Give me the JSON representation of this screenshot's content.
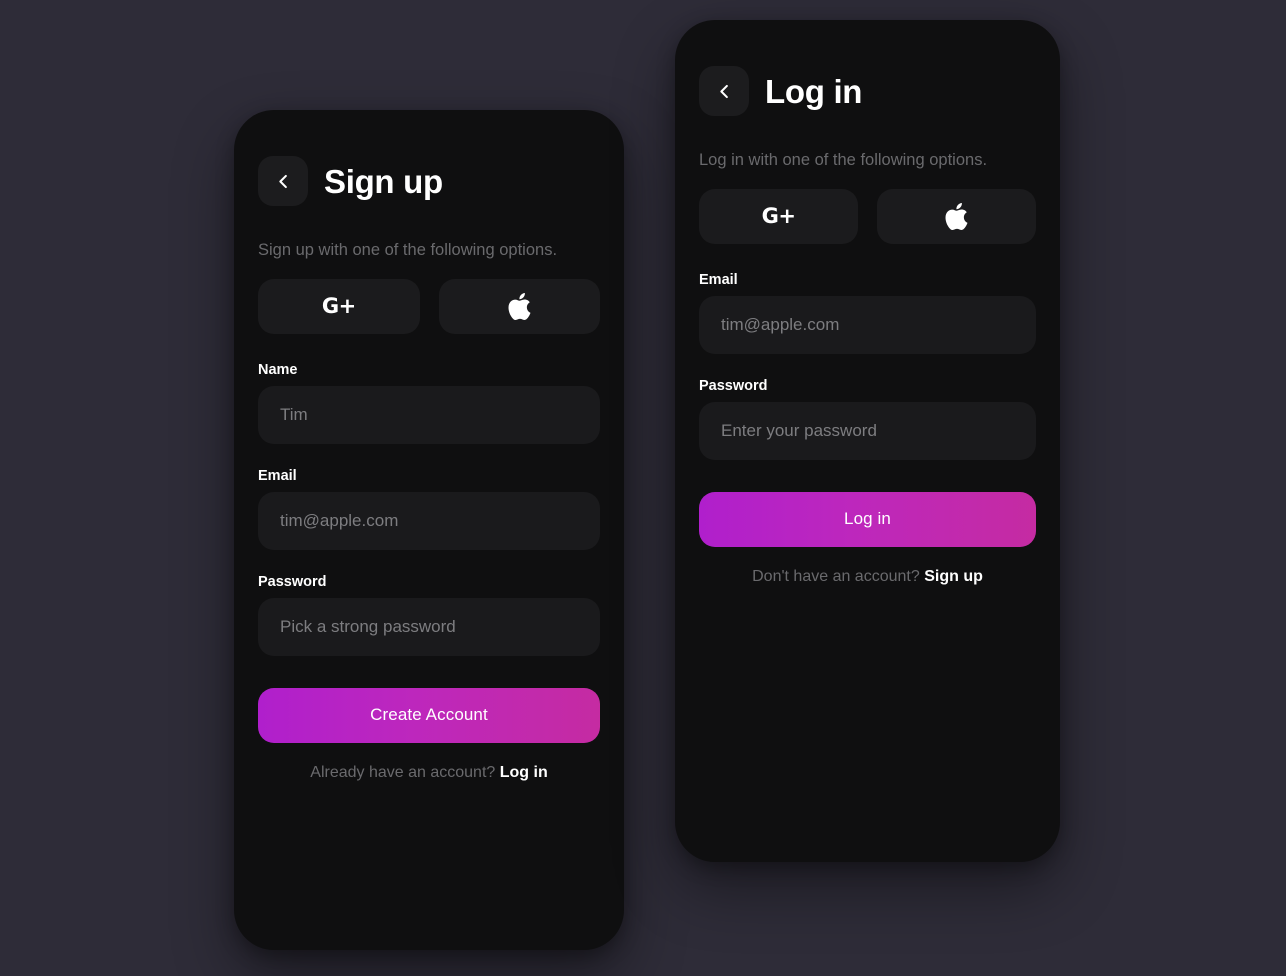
{
  "theme": {
    "page_background": "#2e2c38",
    "card_background": "#0f0f10",
    "input_background": "#1a1a1c",
    "accent_gradient_start": "#b01fcc",
    "accent_gradient_end": "#c52ba2",
    "label_color": "#ffffff",
    "muted_text_color": "#6a6a6d",
    "placeholder_color": "#7d7d80"
  },
  "signup": {
    "back_button_icon": "chevron-left-icon",
    "title": "Sign up",
    "subtitle": "Sign up with one of the following options.",
    "social": [
      {
        "icon": "google-plus-icon",
        "label": "G+"
      },
      {
        "icon": "apple-icon",
        "label": ""
      }
    ],
    "fields": [
      {
        "label": "Name",
        "value": "",
        "placeholder": "Tim",
        "type": "text"
      },
      {
        "label": "Email",
        "value": "",
        "placeholder": "tim@apple.com",
        "type": "email"
      },
      {
        "label": "Password",
        "value": "",
        "placeholder": "Pick a strong password",
        "type": "password"
      }
    ],
    "submit_label": "Create Account",
    "footer_text": "Already have an account?",
    "footer_link": "Log in"
  },
  "login": {
    "back_button_icon": "chevron-left-icon",
    "title": "Log in",
    "subtitle": "Log in with one of the following options.",
    "social": [
      {
        "icon": "google-plus-icon",
        "label": "G+"
      },
      {
        "icon": "apple-icon",
        "label": ""
      }
    ],
    "fields": [
      {
        "label": "Email",
        "value": "",
        "placeholder": "tim@apple.com",
        "type": "email"
      },
      {
        "label": "Password",
        "value": "",
        "placeholder": "Enter your password",
        "type": "password"
      }
    ],
    "submit_label": "Log in",
    "footer_text": "Don't have an account?",
    "footer_link": "Sign up"
  }
}
